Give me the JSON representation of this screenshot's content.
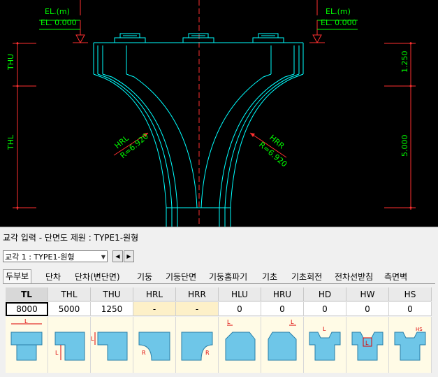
{
  "cad": {
    "el_left_label": "EL.(m)",
    "el_left_value": "EL. 0.000",
    "el_right_label": "EL.(m)",
    "el_right_value": "EL. 0.000",
    "dim_left_top": "THU",
    "dim_left_bottom": "THL",
    "dim_right_top": "1.250",
    "dim_right_bottom": "5.000",
    "hrl_name": "HRL",
    "hrl_radius": "R=6.920",
    "hrr_name": "HRR",
    "hrr_radius": "R=6.920",
    "colors": {
      "background": "#000000",
      "outline": "#00ffff",
      "dimension": "#ff0000",
      "text": "#00ff00",
      "bearing": "#00ffff"
    }
  },
  "panel": {
    "title": "교각 입력 - 단면도 제원 : TYPE1-원형",
    "selector_value": "교각 1 : TYPE1-원형",
    "prev_icon": "◀",
    "next_icon": "▶",
    "tabs": [
      "두부보",
      "단차",
      "단차(변단면)",
      "기둥",
      "기둥단면",
      "기둥홈파기",
      "기초",
      "기초회전",
      "전차선받침",
      "측면벽"
    ],
    "active_tab": "두부보",
    "columns": [
      "TL",
      "THL",
      "THU",
      "HRL",
      "HRR",
      "HLU",
      "HRU",
      "HD",
      "HW",
      "HS"
    ],
    "values": [
      "8000",
      "5000",
      "1250",
      "-",
      "-",
      "0",
      "0",
      "0",
      "0",
      "0"
    ],
    "diagram_labels": {
      "TL": "L",
      "THL": "L",
      "THU": "L",
      "HRL": "R",
      "HRR": "R",
      "HLU": "L",
      "HRU": "L",
      "HD": "L",
      "HW": "L",
      "HS": "HS"
    }
  }
}
